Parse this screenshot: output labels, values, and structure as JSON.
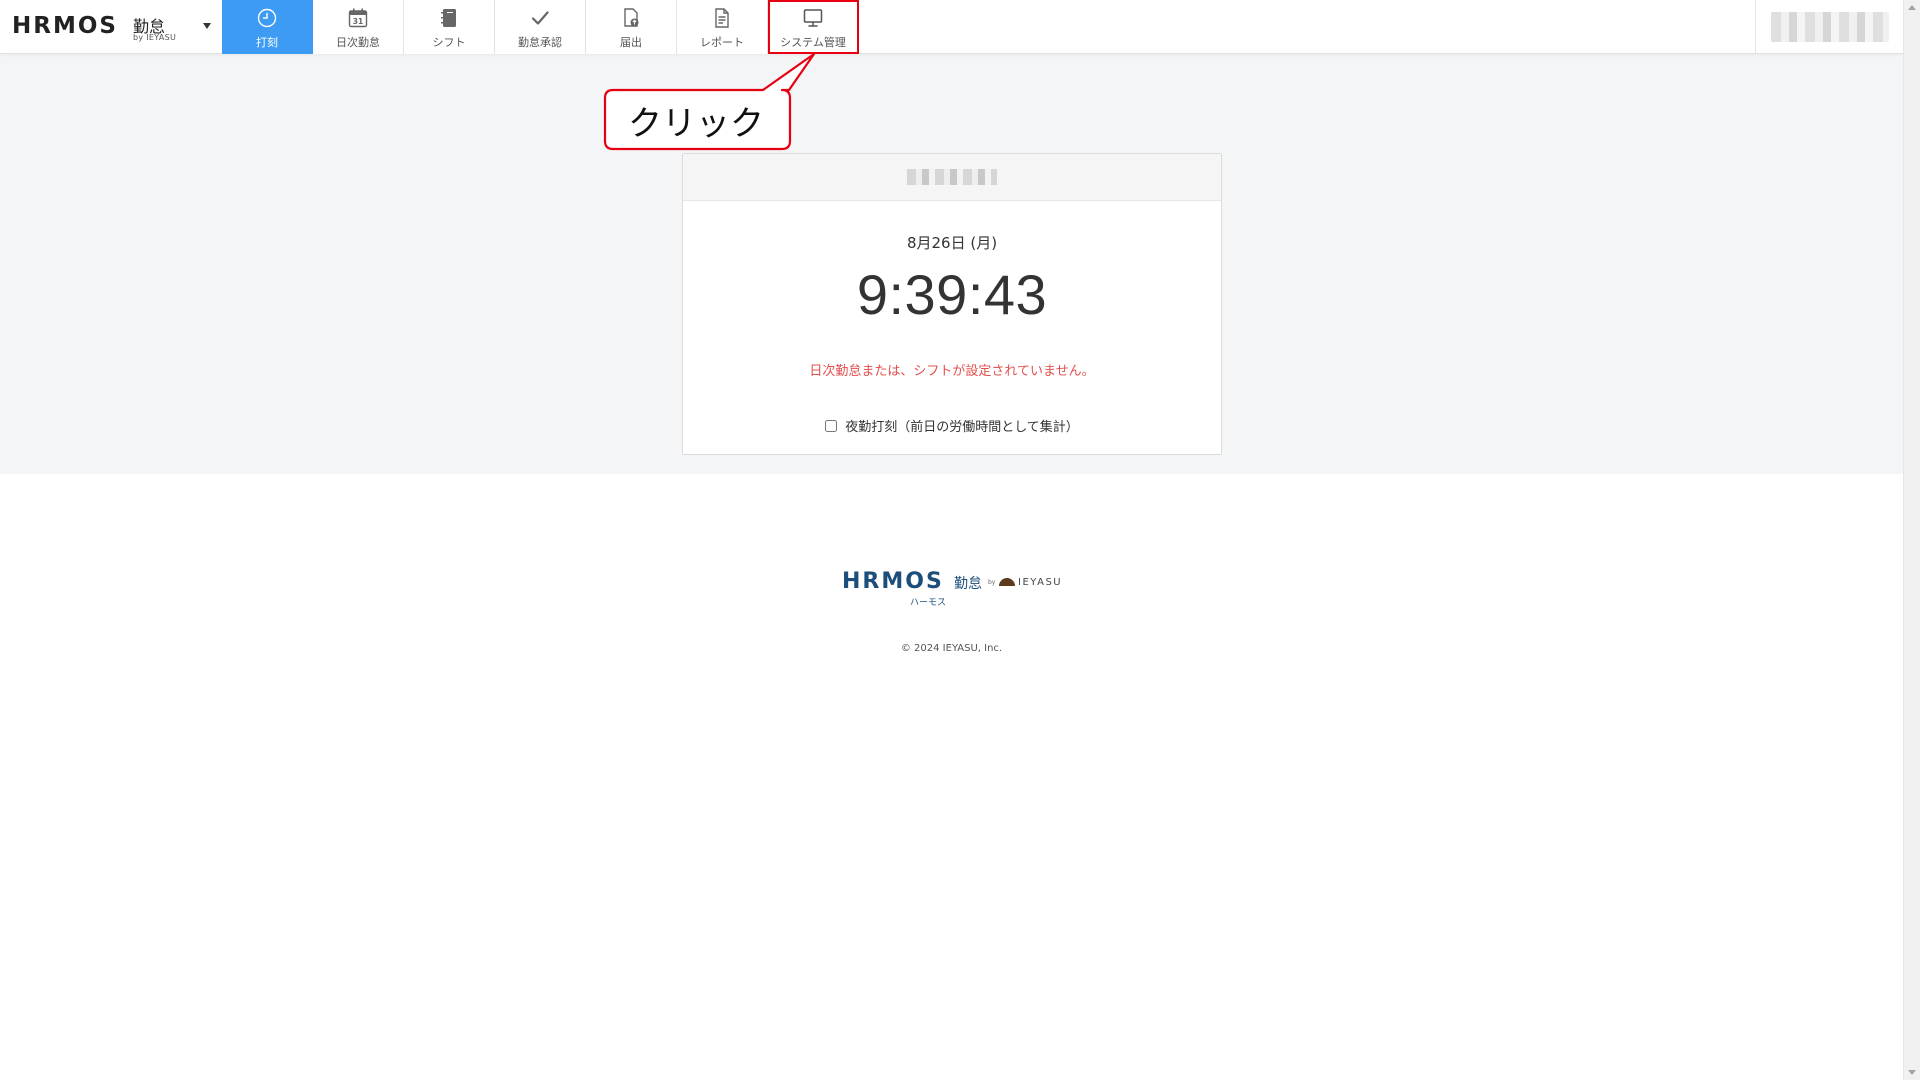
{
  "header": {
    "brand": {
      "logo_text": "HRMOS",
      "product": "勤怠",
      "by_text": "by IEYASU"
    },
    "nav": [
      {
        "id": "stamp",
        "label": "打刻",
        "icon": "clock-icon",
        "active": true
      },
      {
        "id": "daily",
        "label": "日次勤怠",
        "icon": "calendar-icon",
        "calendar_day": "31"
      },
      {
        "id": "shift",
        "label": "シフト",
        "icon": "notebook-icon"
      },
      {
        "id": "approve",
        "label": "勤怠承認",
        "icon": "checkmark-icon"
      },
      {
        "id": "request",
        "label": "届出",
        "icon": "document-upload-icon"
      },
      {
        "id": "report",
        "label": "レポート",
        "icon": "report-document-icon"
      },
      {
        "id": "system",
        "label": "システム管理",
        "icon": "monitor-icon",
        "highlighted": true
      }
    ]
  },
  "card": {
    "date": "8月26日 (月)",
    "time": "9:39:43",
    "warning": "日次勤怠または、シフトが設定されていません。",
    "night_checkbox_label": "夜勤打刻（前日の労働時間として集計）",
    "night_checkbox_checked": false
  },
  "annotation": {
    "text": "クリック"
  },
  "footer": {
    "logo_text": "HRMOS",
    "product": "勤怠",
    "kana": "ハーモス",
    "by_text": "by",
    "company_logo_text": "IEYASU",
    "copyright": "© 2024 IEYASU, Inc."
  },
  "colors": {
    "active_tab": "#3d9bf3",
    "warning": "#e2504e",
    "annotation_red": "#e60012",
    "footer_logo": "#1b4e7a"
  }
}
